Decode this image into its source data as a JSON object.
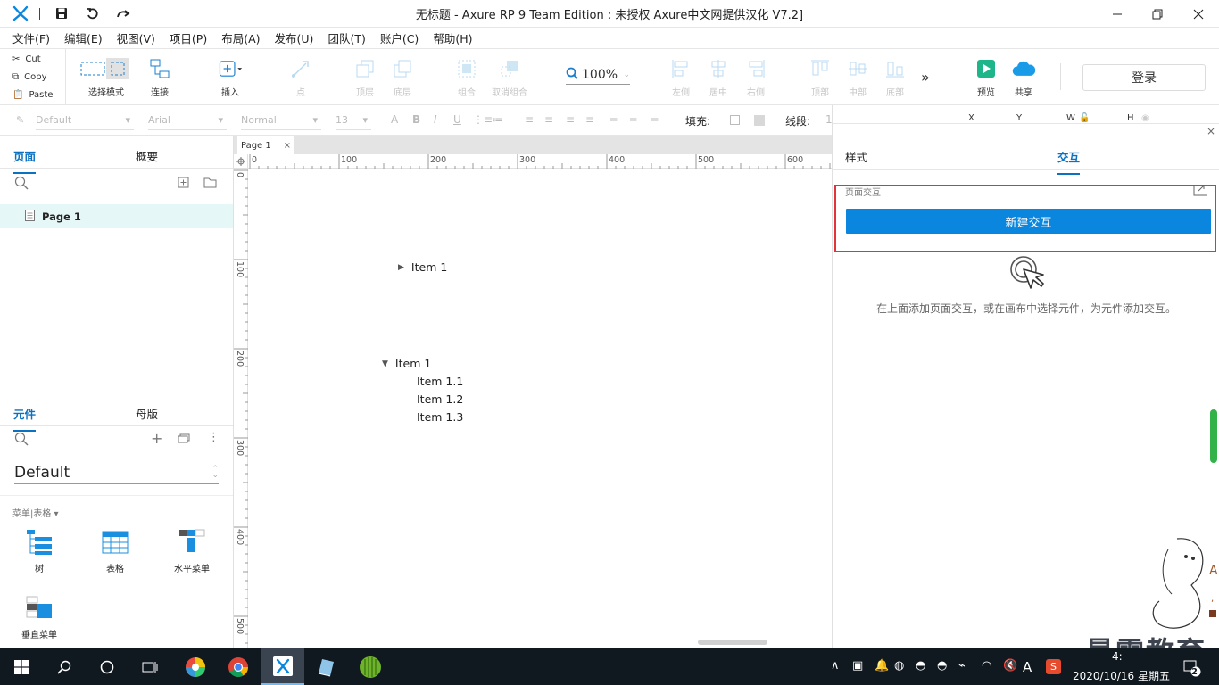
{
  "window": {
    "title": "无标题 - Axure RP 9 Team Edition : 未授权    Axure中文网提供汉化 V7.2]",
    "minimize_icon": "minimize-icon",
    "maximize_icon": "restore-icon",
    "close_icon": "close-icon"
  },
  "menu": [
    "文件(F)",
    "编辑(E)",
    "视图(V)",
    "项目(P)",
    "布局(A)",
    "发布(U)",
    "团队(T)",
    "账户(C)",
    "帮助(H)"
  ],
  "clipboard": {
    "cut": "Cut",
    "copy": "Copy",
    "paste": "Paste"
  },
  "toolbar": {
    "select_mode": "选择模式",
    "connect": "连接",
    "insert": "插入",
    "point": "点",
    "top": "顶层",
    "bottom": "底层",
    "group": "组合",
    "ungroup": "取消组合",
    "zoom": "100%",
    "align_left": "左侧",
    "align_center": "居中",
    "align_right": "右侧",
    "align_top": "顶部",
    "align_middle": "中部",
    "align_bottom": "底部",
    "preview": "预览",
    "share": "共享",
    "login": "登录"
  },
  "format": {
    "style": "Default",
    "font": "Arial",
    "weight": "Normal",
    "size": "13",
    "fill_label": "填充:",
    "line_label": "线段:",
    "line_value": "1",
    "x": "X",
    "y": "Y",
    "w": "W",
    "h": "H"
  },
  "pages_panel": {
    "tab_pages": "页面",
    "tab_outline": "概要",
    "page_name": "Page 1"
  },
  "library_panel": {
    "tab_widgets": "元件",
    "tab_masters": "母版",
    "library": "Default",
    "category": "菜单|表格 ▾",
    "widgets": [
      "树",
      "表格",
      "水平菜单",
      "垂直菜单"
    ]
  },
  "canvas": {
    "tab": "Page 1",
    "hruler": [
      "0",
      "100",
      "200",
      "300",
      "400",
      "500",
      "600"
    ],
    "vruler": [
      "0",
      "100",
      "200",
      "300",
      "400",
      "500"
    ],
    "tree1": "Item 1",
    "tree2_root": "Item 1",
    "tree2_children": [
      "Item 1.1",
      "Item 1.2",
      "Item 1.3"
    ]
  },
  "right_panel": {
    "tab_style": "样式",
    "tab_interactions": "交互",
    "page_interactions": "页面交互",
    "new_interaction": "新建交互",
    "hint": "在上面添加页面交互，或在画布中选择元件，为元件添加交互。"
  },
  "taskbar": {
    "clock_time": "4:",
    "clock_date": "2020/10/16 星期五",
    "badge": "2",
    "ime": "A"
  },
  "watermark": "最需教育",
  "colors": {
    "accent": "#0a72c0",
    "button": "#0a86de",
    "highlight": "#e0333a"
  }
}
